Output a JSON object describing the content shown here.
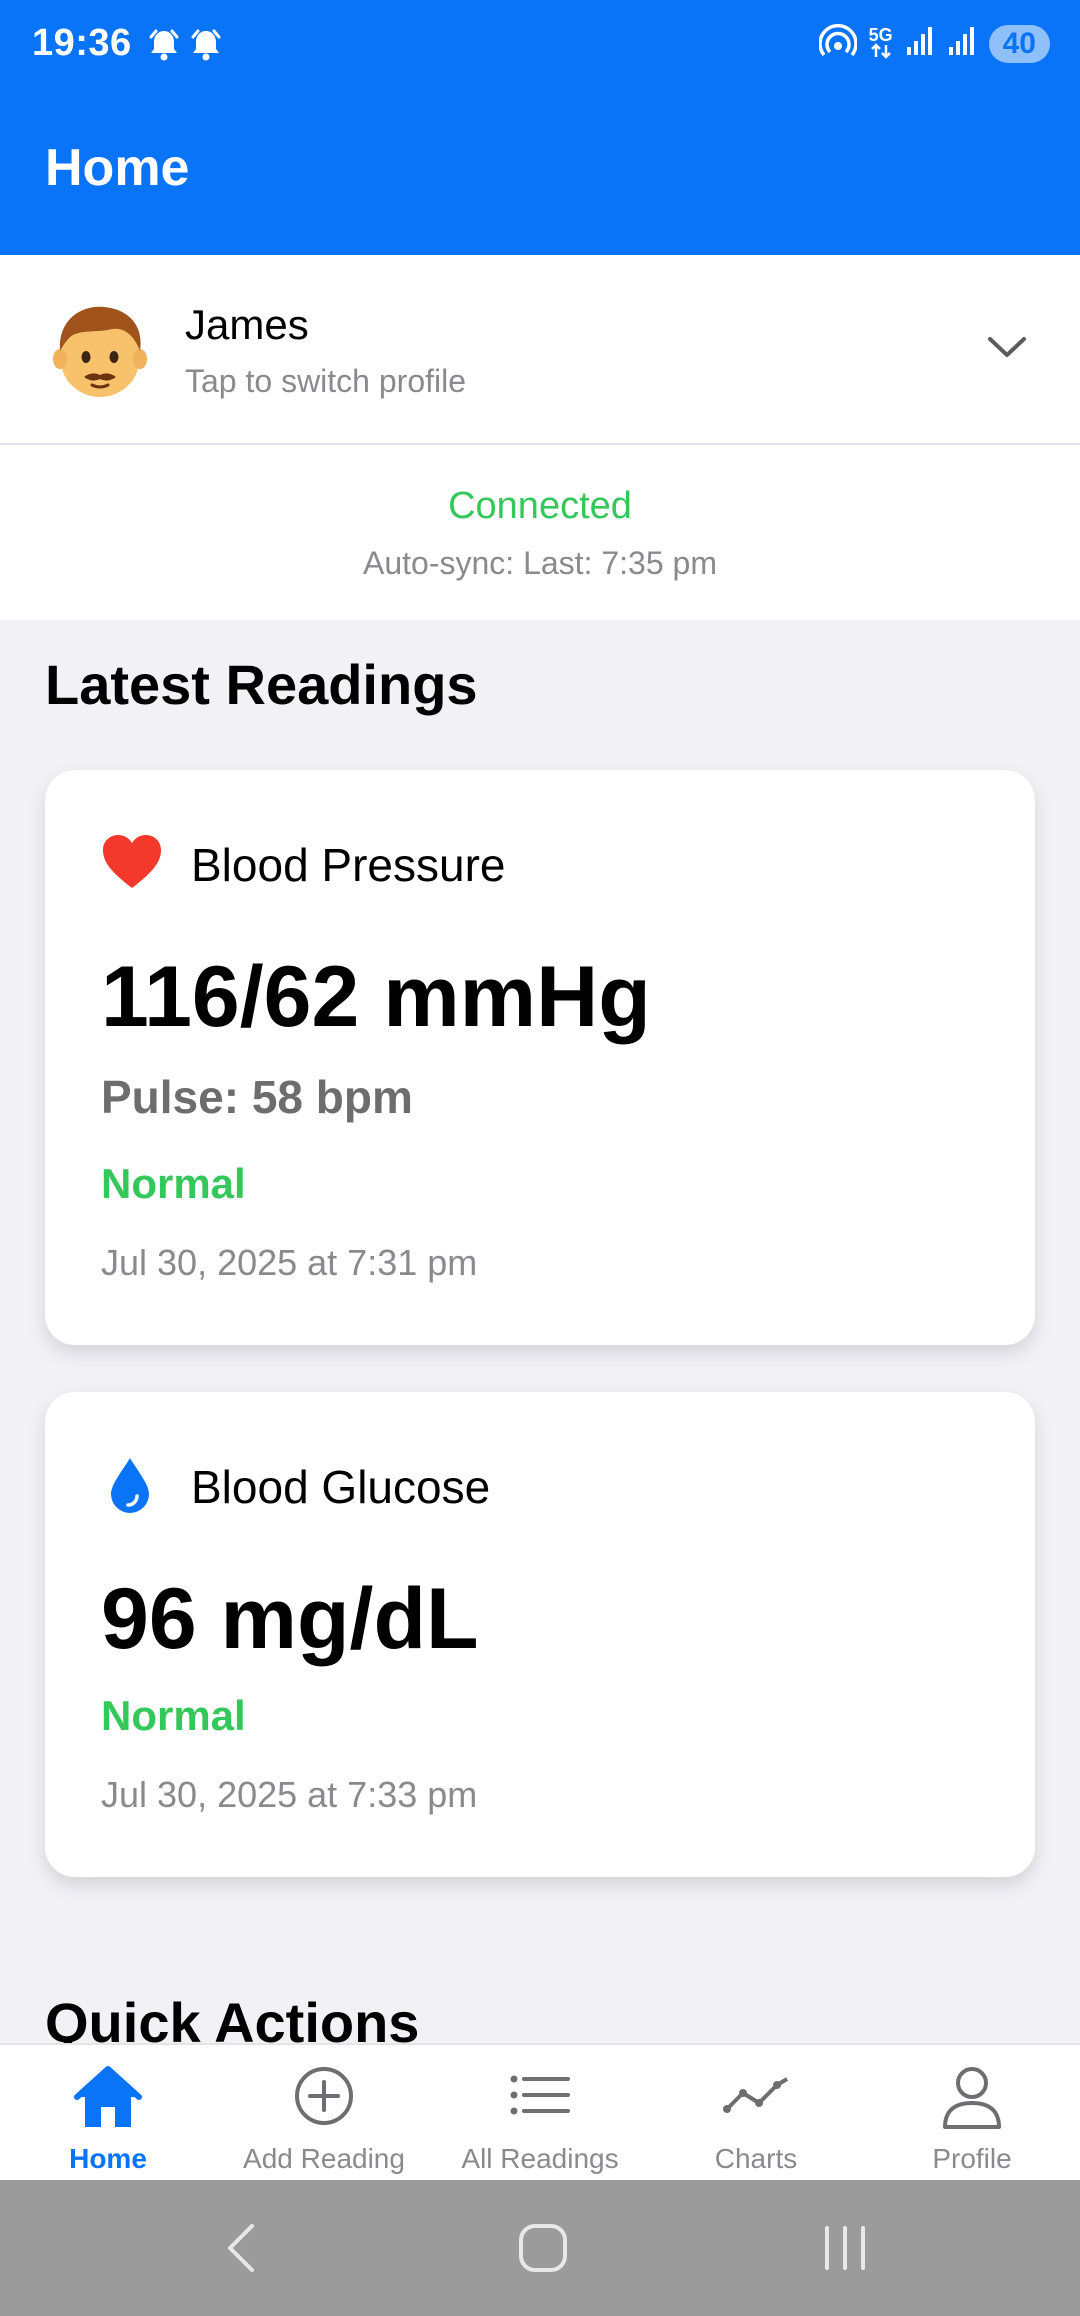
{
  "status_bar": {
    "time": "19:36",
    "left_icons": [
      "alarm-icon",
      "alarm-icon"
    ],
    "right_icons": [
      "hotspot-icon",
      "5g-icon",
      "signal-icon",
      "signal-icon"
    ],
    "network_label": "5G",
    "battery": "40"
  },
  "header": {
    "title": "Home"
  },
  "profile": {
    "avatar": "boy-face-avatar",
    "name": "James",
    "hint": "Tap to switch profile"
  },
  "connection": {
    "status": "Connected",
    "sync": "Auto-sync: Last: 7:35 pm"
  },
  "latest_readings": {
    "title": "Latest Readings",
    "cards": [
      {
        "icon": "heart-icon",
        "label": "Blood Pressure",
        "value": "116/62 mmHg",
        "pulse": "Pulse: 58 bpm",
        "status": "Normal",
        "date": "Jul 30, 2025 at 7:31 pm"
      },
      {
        "icon": "droplet-icon",
        "label": "Blood Glucose",
        "value": "96 mg/dL",
        "status": "Normal",
        "date": "Jul 30, 2025 at 7:33 pm"
      }
    ]
  },
  "quick_actions": {
    "title": "Quick Actions"
  },
  "tab_bar": {
    "active": "Home",
    "tabs": [
      {
        "label": "Home",
        "icon": "home-icon"
      },
      {
        "label": "Add Reading",
        "icon": "plus-circle-icon"
      },
      {
        "label": "All Readings",
        "icon": "list-icon"
      },
      {
        "label": "Charts",
        "icon": "chart-line-icon"
      },
      {
        "label": "Profile",
        "icon": "person-icon"
      }
    ]
  },
  "colors": {
    "accent": "#0a74f8",
    "normal": "#34c759",
    "heart": "#f2392c",
    "muted": "#8a8a8e"
  }
}
